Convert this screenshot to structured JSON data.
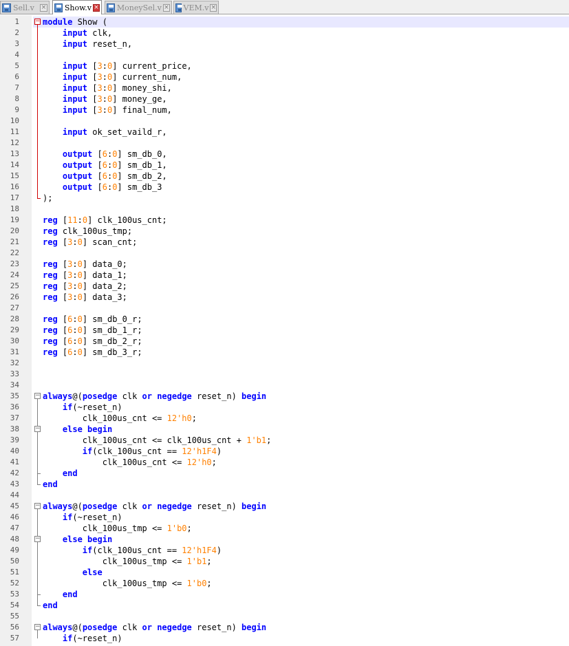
{
  "tabs": [
    {
      "label": "Sell.v",
      "active": false
    },
    {
      "label": "Show.v",
      "active": true
    },
    {
      "label": "MoneySel.v",
      "active": false
    },
    {
      "label": "VEM.v",
      "active": false
    }
  ],
  "colors": {
    "keyword": "#0000ff",
    "number": "#ff8000",
    "fold_marker_active": "#d00000",
    "line_highlight": "#e8e8ff"
  },
  "icons": {
    "tab": "save-disk-icon",
    "close": "close-icon",
    "fold": "fold-toggle-icon"
  },
  "code_lines": [
    {
      "n": "1",
      "text": "module Show ("
    },
    {
      "n": "2",
      "text": "    input clk,"
    },
    {
      "n": "3",
      "text": "    input reset_n,"
    },
    {
      "n": "4",
      "text": ""
    },
    {
      "n": "5",
      "text": "    input [3:0] current_price,"
    },
    {
      "n": "6",
      "text": "    input [3:0] current_num,"
    },
    {
      "n": "7",
      "text": "    input [3:0] money_shi,"
    },
    {
      "n": "8",
      "text": "    input [3:0] money_ge,"
    },
    {
      "n": "9",
      "text": "    input [3:0] final_num,"
    },
    {
      "n": "10",
      "text": ""
    },
    {
      "n": "11",
      "text": "    input ok_set_vaild_r,"
    },
    {
      "n": "12",
      "text": ""
    },
    {
      "n": "13",
      "text": "    output [6:0] sm_db_0,"
    },
    {
      "n": "14",
      "text": "    output [6:0] sm_db_1,"
    },
    {
      "n": "15",
      "text": "    output [6:0] sm_db_2,"
    },
    {
      "n": "16",
      "text": "    output [6:0] sm_db_3"
    },
    {
      "n": "17",
      "text": ");"
    },
    {
      "n": "18",
      "text": ""
    },
    {
      "n": "19",
      "text": "reg [11:0] clk_100us_cnt;"
    },
    {
      "n": "20",
      "text": "reg clk_100us_tmp;"
    },
    {
      "n": "21",
      "text": "reg [3:0] scan_cnt;"
    },
    {
      "n": "22",
      "text": ""
    },
    {
      "n": "23",
      "text": "reg [3:0] data_0;"
    },
    {
      "n": "24",
      "text": "reg [3:0] data_1;"
    },
    {
      "n": "25",
      "text": "reg [3:0] data_2;"
    },
    {
      "n": "26",
      "text": "reg [3:0] data_3;"
    },
    {
      "n": "27",
      "text": ""
    },
    {
      "n": "28",
      "text": "reg [6:0] sm_db_0_r;"
    },
    {
      "n": "29",
      "text": "reg [6:0] sm_db_1_r;"
    },
    {
      "n": "30",
      "text": "reg [6:0] sm_db_2_r;"
    },
    {
      "n": "31",
      "text": "reg [6:0] sm_db_3_r;"
    },
    {
      "n": "32",
      "text": ""
    },
    {
      "n": "33",
      "text": ""
    },
    {
      "n": "34",
      "text": ""
    },
    {
      "n": "35",
      "text": "always@(posedge clk or negedge reset_n) begin"
    },
    {
      "n": "36",
      "text": "    if(~reset_n)"
    },
    {
      "n": "37",
      "text": "        clk_100us_cnt <= 12'h0;"
    },
    {
      "n": "38",
      "text": "    else begin"
    },
    {
      "n": "39",
      "text": "        clk_100us_cnt <= clk_100us_cnt + 1'b1;"
    },
    {
      "n": "40",
      "text": "        if(clk_100us_cnt == 12'h1F4)"
    },
    {
      "n": "41",
      "text": "            clk_100us_cnt <= 12'h0;"
    },
    {
      "n": "42",
      "text": "    end"
    },
    {
      "n": "43",
      "text": "end"
    },
    {
      "n": "44",
      "text": ""
    },
    {
      "n": "45",
      "text": "always@(posedge clk or negedge reset_n) begin"
    },
    {
      "n": "46",
      "text": "    if(~reset_n)"
    },
    {
      "n": "47",
      "text": "        clk_100us_tmp <= 1'b0;"
    },
    {
      "n": "48",
      "text": "    else begin"
    },
    {
      "n": "49",
      "text": "        if(clk_100us_cnt == 12'h1F4)"
    },
    {
      "n": "50",
      "text": "            clk_100us_tmp <= 1'b1;"
    },
    {
      "n": "51",
      "text": "        else"
    },
    {
      "n": "52",
      "text": "            clk_100us_tmp <= 1'b0;"
    },
    {
      "n": "53",
      "text": "    end"
    },
    {
      "n": "54",
      "text": "end"
    },
    {
      "n": "55",
      "text": ""
    },
    {
      "n": "56",
      "text": "always@(posedge clk or negedge reset_n) begin"
    },
    {
      "n": "57",
      "text": "    if(~reset_n)"
    }
  ],
  "folds": [
    {
      "line": 1,
      "end": 17,
      "kind": "module",
      "active": true
    },
    {
      "line": 35,
      "end": 43,
      "kind": "always",
      "active": false
    },
    {
      "line": 38,
      "end": 42,
      "kind": "begin",
      "active": false
    },
    {
      "line": 45,
      "end": 54,
      "kind": "always",
      "active": false
    },
    {
      "line": 48,
      "end": 53,
      "kind": "begin",
      "active": false
    },
    {
      "line": 56,
      "end": 57,
      "kind": "always",
      "active": false
    }
  ]
}
